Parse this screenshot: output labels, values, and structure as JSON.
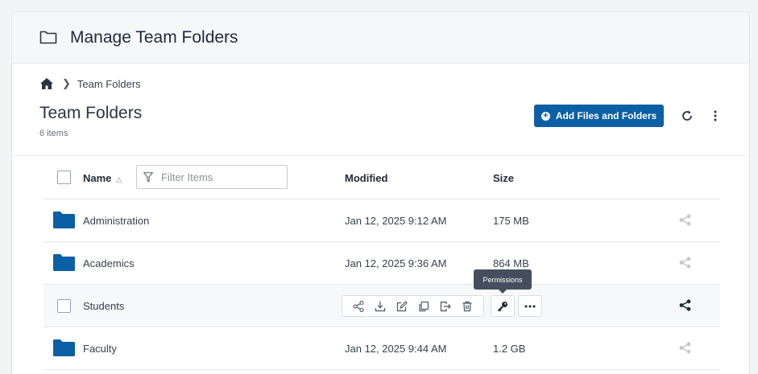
{
  "app": {
    "title": "Manage Team Folders"
  },
  "breadcrumb": {
    "items": [
      "Team Folders"
    ]
  },
  "page": {
    "title": "Team Folders",
    "item_count": "6 items"
  },
  "toolbar": {
    "add_label": "Add Files and Folders"
  },
  "table": {
    "columns": {
      "name": "Name",
      "modified": "Modified",
      "size": "Size"
    },
    "filter_placeholder": "Filter Items",
    "rows": [
      {
        "name": "Administration",
        "modified": "Jan 12, 2025 9:12 AM",
        "size": "175 MB"
      },
      {
        "name": "Academics",
        "modified": "Jan 12, 2025 9:36 AM",
        "size": "864 MB"
      },
      {
        "name": "Students",
        "modified": "",
        "size": ""
      },
      {
        "name": "Faculty",
        "modified": "Jan 12, 2025 9:44 AM",
        "size": "1.2 GB"
      }
    ]
  },
  "tooltip": {
    "text": "Permissions"
  },
  "colors": {
    "accent": "#0b5fa5",
    "folder": "#0b5fa5",
    "tooltip_bg": "#454e5c"
  }
}
